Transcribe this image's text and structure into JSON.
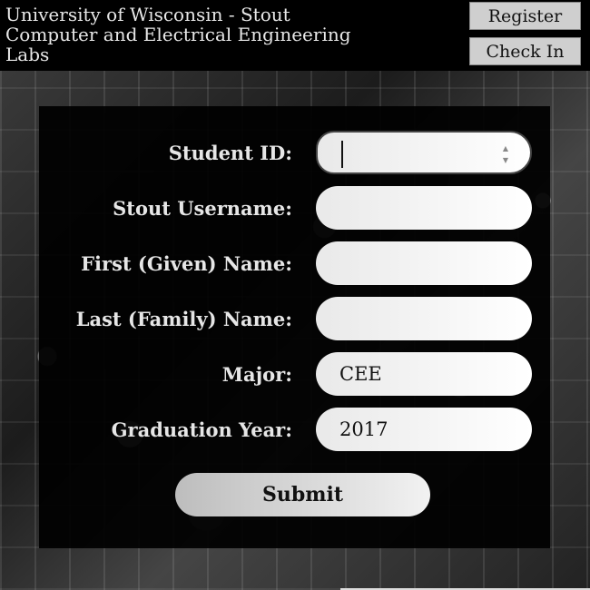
{
  "header": {
    "title_lines": [
      "University of Wisconsin - Stout",
      "Computer and Electrical Engineering",
      "Labs"
    ],
    "nav": {
      "register": "Register",
      "check_in": "Check In"
    }
  },
  "form": {
    "student_id": {
      "label": "Student ID:",
      "value": ""
    },
    "stout_username": {
      "label": "Stout Username:",
      "value": ""
    },
    "first_name": {
      "label": "First (Given) Name:",
      "value": ""
    },
    "last_name": {
      "label": "Last (Family) Name:",
      "value": ""
    },
    "major": {
      "label": "Major:",
      "value": "CEE"
    },
    "graduation_year": {
      "label": "Graduation Year:",
      "value": "2017"
    },
    "submit": "Submit"
  },
  "icons": {
    "spinner_up": "▲",
    "spinner_down": "▼"
  }
}
